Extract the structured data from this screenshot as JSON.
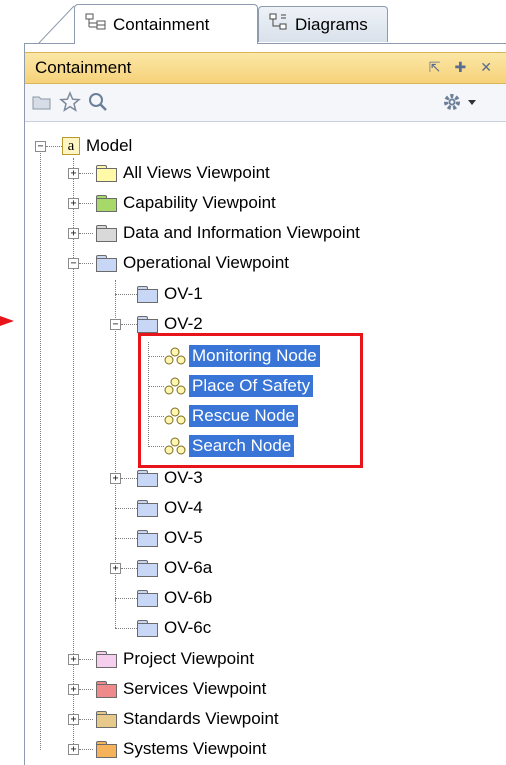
{
  "tabs": [
    {
      "label": "Containment",
      "icon": "containment-tree-icon",
      "active": true
    },
    {
      "label": "Diagrams",
      "icon": "diagrams-icon",
      "active": false
    }
  ],
  "panel": {
    "title": "Containment",
    "header_buttons": [
      "restore-icon",
      "pin-icon",
      "close-icon"
    ]
  },
  "toolbar": {
    "left_icons": [
      "open-folder-icon",
      "star-icon",
      "search-icon"
    ],
    "right_icons": [
      "gear-icon",
      "dropdown-arrow-icon"
    ]
  },
  "tree": {
    "root": {
      "label": "Model",
      "icon_text": "a"
    },
    "items": [
      {
        "label": "All Views Viewpoint",
        "color": "#fff9a8"
      },
      {
        "label": "Capability Viewpoint",
        "color": "#a6d96a"
      },
      {
        "label": "Data and Information Viewpoint",
        "color": "#d9d9d9"
      },
      {
        "label": "Operational Viewpoint",
        "color": "#c9d7f7"
      },
      {
        "label": "OV-1",
        "color": "#c9d7f7"
      },
      {
        "label": "OV-2",
        "color": "#c9d7f7"
      },
      {
        "label": "Monitoring Node"
      },
      {
        "label": "Place Of Safety"
      },
      {
        "label": "Rescue Node"
      },
      {
        "label": "Search Node"
      },
      {
        "label": "OV-3",
        "color": "#c9d7f7"
      },
      {
        "label": "OV-4",
        "color": "#c9d7f7"
      },
      {
        "label": "OV-5",
        "color": "#c9d7f7"
      },
      {
        "label": "OV-6a",
        "color": "#c9d7f7"
      },
      {
        "label": "OV-6b",
        "color": "#c9d7f7"
      },
      {
        "label": "OV-6c",
        "color": "#c9d7f7"
      },
      {
        "label": "Project Viewpoint",
        "color": "#f6cfee"
      },
      {
        "label": "Services Viewpoint",
        "color": "#f08a8a"
      },
      {
        "label": "Standards Viewpoint",
        "color": "#e7c98a"
      },
      {
        "label": "Systems Viewpoint",
        "color": "#f6b25a"
      }
    ]
  },
  "highlight_color": "#e8141a",
  "selection_color": "#3875d7"
}
